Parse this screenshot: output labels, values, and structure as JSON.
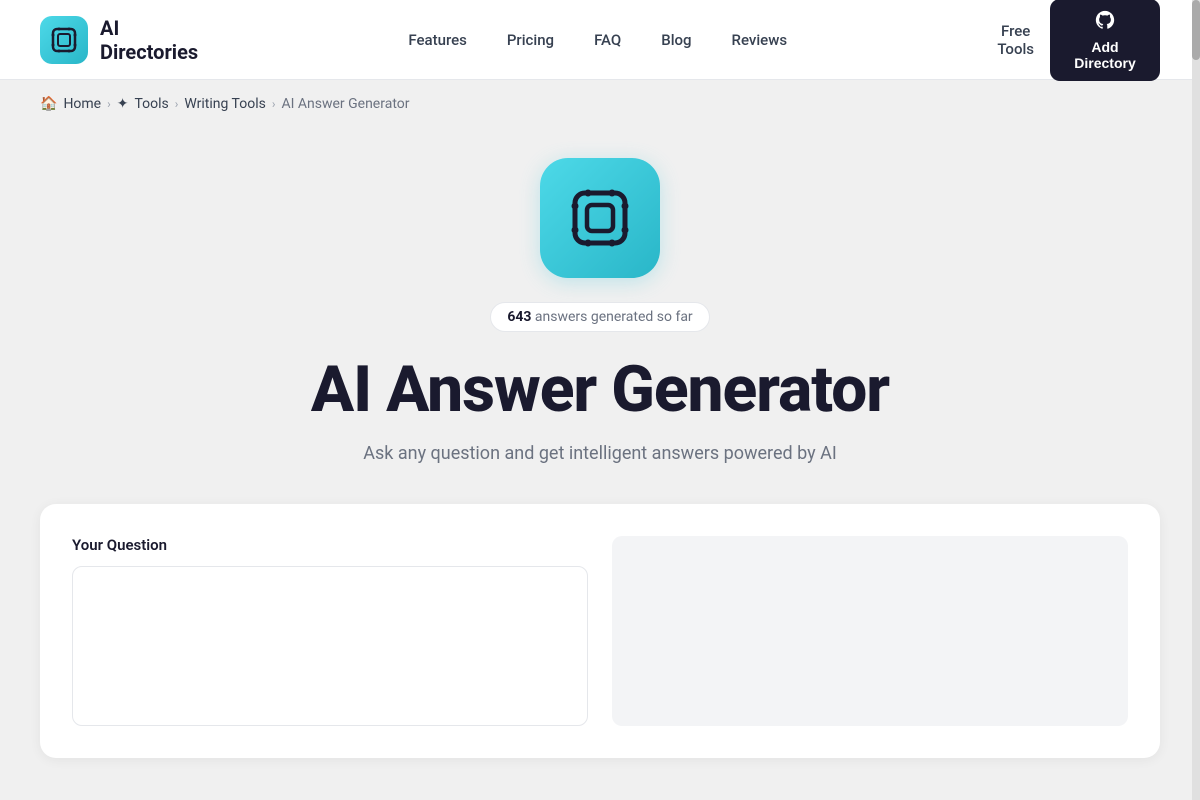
{
  "header": {
    "logo_text_line1": "AI",
    "logo_text_line2": "Directories",
    "nav": {
      "features": "Features",
      "pricing": "Pricing",
      "faq": "FAQ",
      "blog": "Blog",
      "reviews": "Reviews",
      "free_tools": "Free\nTools"
    },
    "github_button": {
      "icon": "⊙",
      "label": "Add\nDirectory"
    }
  },
  "breadcrumb": {
    "home": "Home",
    "tools": "Tools",
    "writing_tools": "Writing Tools",
    "current": "AI Answer Generator"
  },
  "hero": {
    "stats_count": "643",
    "stats_text": "answers generated so far",
    "title": "AI Answer Generator",
    "subtitle": "Ask any question and get intelligent answers powered by AI"
  },
  "form": {
    "question_label": "Your Question",
    "question_placeholder": ""
  }
}
